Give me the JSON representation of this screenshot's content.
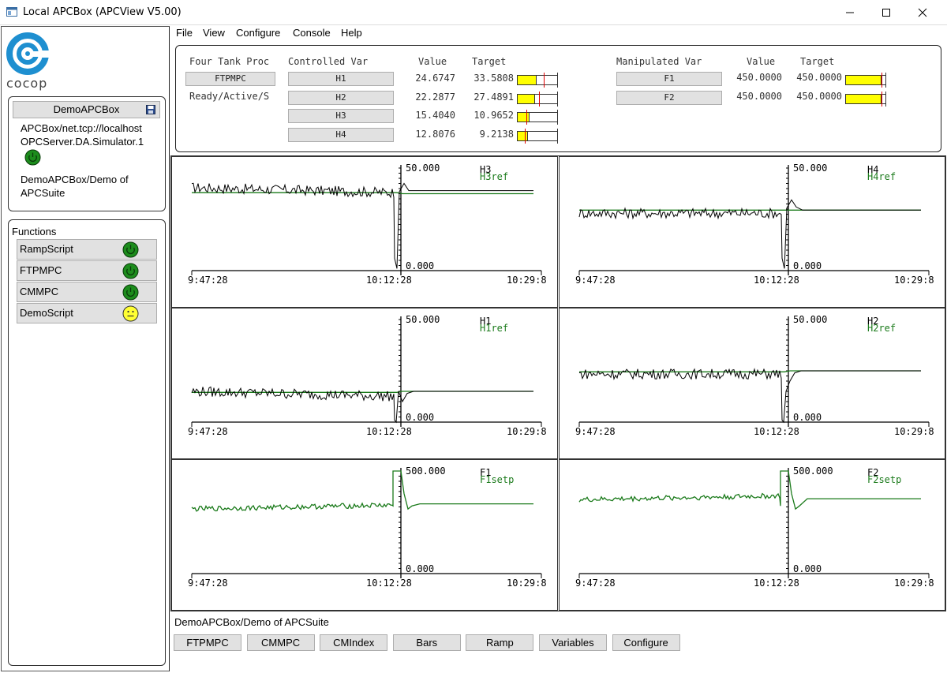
{
  "window": {
    "title": "Local APCBox (APCView V5.00)",
    "minimize_icon": "minimize-icon",
    "maximize_icon": "maximize-icon",
    "close_icon": "close-icon"
  },
  "logo": {
    "text": "cocop"
  },
  "box": {
    "title": "DemoAPCBox",
    "connection_line1": "APCBox/net.tcp://localhost",
    "connection_line2": "OPCServer.DA.Simulator.1",
    "description_line1": "DemoAPCBox/Demo of",
    "description_line2": "APCSuite",
    "status": "ok"
  },
  "functions": {
    "title": "Functions",
    "items": [
      {
        "label": "RampScript",
        "status": "ok"
      },
      {
        "label": "FTPMPC",
        "status": "ok"
      },
      {
        "label": "CMMPC",
        "status": "ok"
      },
      {
        "label": "DemoScript",
        "status": "neutral"
      }
    ]
  },
  "menu": [
    "File",
    "View",
    "Configure",
    "Console",
    "Help"
  ],
  "summary": {
    "process_name": "Four Tank Proc",
    "controller_button": "FTPMPC",
    "state": "Ready/Active/S",
    "cv_header": "Controlled Var",
    "value_header": "Value",
    "target_header": "Target",
    "mv_header": "Manipulated Var",
    "cvs": [
      {
        "name": "H1",
        "value": "24.6747",
        "target": "33.5808",
        "fill": 0.48,
        "target_frac": 0.65
      },
      {
        "name": "H2",
        "value": "22.2877",
        "target": "27.4891",
        "fill": 0.43,
        "target_frac": 0.53
      },
      {
        "name": "H3",
        "value": "15.4040",
        "target": "10.9652",
        "fill": 0.3,
        "target_frac": 0.22
      },
      {
        "name": "H4",
        "value": "12.8076",
        "target": "9.2138",
        "fill": 0.25,
        "target_frac": 0.18
      }
    ],
    "mvs": [
      {
        "name": "F1",
        "value": "450.0000",
        "target": "450.0000",
        "fill": 0.9,
        "target_frac": 0.9
      },
      {
        "name": "F2",
        "value": "450.0000",
        "target": "450.0000",
        "fill": 0.9,
        "target_frac": 0.9
      }
    ],
    "colors": {
      "bar_fill": "#ffff00",
      "target_marker": "#e00000"
    }
  },
  "plots": [
    {
      "ymax": "50.000",
      "ymin": "0.000",
      "series": [
        "H3",
        "H3ref"
      ],
      "x_start": "9:47:28",
      "x_mid": "10:12:28",
      "x_end": "10:29:8"
    },
    {
      "ymax": "50.000",
      "ymin": "0.000",
      "series": [
        "H4",
        "H4ref"
      ],
      "x_start": "9:47:28",
      "x_mid": "10:12:28",
      "x_end": "10:29:8"
    },
    {
      "ymax": "50.000",
      "ymin": "0.000",
      "series": [
        "H1",
        "H1ref"
      ],
      "x_start": "9:47:28",
      "x_mid": "10:12:28",
      "x_end": "10:29:8"
    },
    {
      "ymax": "50.000",
      "ymin": "0.000",
      "series": [
        "H2",
        "H2ref"
      ],
      "x_start": "9:47:28",
      "x_mid": "10:12:28",
      "x_end": "10:29:8"
    },
    {
      "ymax": "500.000",
      "ymin": "0.000",
      "series": [
        "F1",
        "F1setp"
      ],
      "x_start": "9:47:28",
      "x_mid": "10:12:28",
      "x_end": "10:29:8"
    },
    {
      "ymax": "500.000",
      "ymin": "0.000",
      "series": [
        "F2",
        "F2setp"
      ],
      "x_start": "9:47:28",
      "x_mid": "10:12:28",
      "x_end": "10:29:8"
    }
  ],
  "plot_colors": {
    "measured": "#000000",
    "reference": "#1a7a1a"
  },
  "bottom": {
    "title": "DemoAPCBox/Demo of APCSuite",
    "buttons": [
      "FTPMPC",
      "CMMPC",
      "CMIndex",
      "Bars",
      "Ramp",
      "Variables",
      "Configure"
    ]
  }
}
